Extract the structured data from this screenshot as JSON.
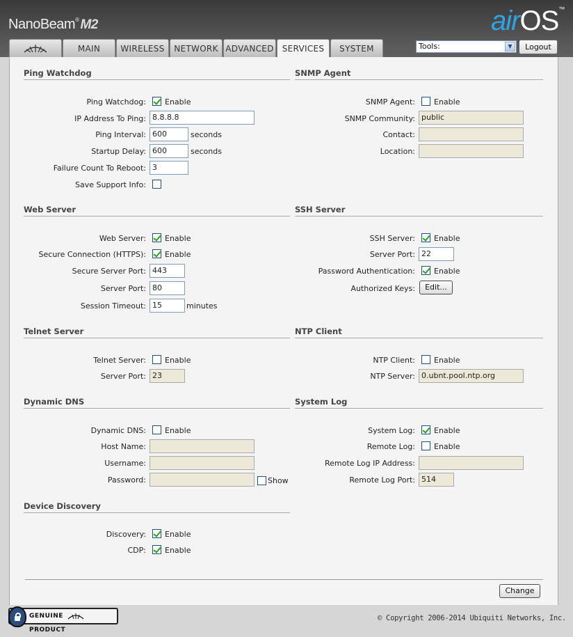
{
  "header": {
    "product_name": "NanoBeam",
    "product_tm": "®",
    "product_model": "M2",
    "brand_air": "air",
    "brand_os": "OS",
    "brand_tm": "™"
  },
  "tabs": [
    {
      "label": "",
      "icon": "ubiquiti-logo-icon"
    },
    {
      "label": "MAIN"
    },
    {
      "label": "WIRELESS"
    },
    {
      "label": "NETWORK"
    },
    {
      "label": "ADVANCED"
    },
    {
      "label": "SERVICES",
      "active": true
    },
    {
      "label": "SYSTEM"
    }
  ],
  "toolbar": {
    "tools_value": "Tools:",
    "logout_label": "Logout"
  },
  "common": {
    "enable": "Enable",
    "seconds": "seconds",
    "minutes": "minutes",
    "show": "Show"
  },
  "ping_watchdog": {
    "title": "Ping Watchdog",
    "enable_label": "Ping Watchdog:",
    "enabled": true,
    "ip_label": "IP Address To Ping:",
    "ip_value": "8.8.8.8",
    "interval_label": "Ping Interval:",
    "interval_value": "600",
    "startup_label": "Startup Delay:",
    "startup_value": "600",
    "failure_label": "Failure Count To Reboot:",
    "failure_value": "3",
    "support_label": "Save Support Info:",
    "support_checked": false
  },
  "snmp": {
    "title": "SNMP Agent",
    "enable_label": "SNMP Agent:",
    "enabled": false,
    "community_label": "SNMP Community:",
    "community_value": "public",
    "contact_label": "Contact:",
    "contact_value": "",
    "location_label": "Location:",
    "location_value": ""
  },
  "web_server": {
    "title": "Web Server",
    "enable_label": "Web Server:",
    "enabled": true,
    "https_label": "Secure Connection (HTTPS):",
    "https_enabled": true,
    "secure_port_label": "Secure Server Port:",
    "secure_port_value": "443",
    "port_label": "Server Port:",
    "port_value": "80",
    "timeout_label": "Session Timeout:",
    "timeout_value": "15"
  },
  "ssh": {
    "title": "SSH Server",
    "enable_label": "SSH Server:",
    "enabled": true,
    "port_label": "Server Port:",
    "port_value": "22",
    "password_label": "Password Authentication:",
    "password_enabled": true,
    "keys_label": "Authorized Keys:",
    "edit_label": "Edit..."
  },
  "telnet": {
    "title": "Telnet Server",
    "enable_label": "Telnet Server:",
    "enabled": false,
    "port_label": "Server Port:",
    "port_value": "23"
  },
  "ntp": {
    "title": "NTP Client",
    "enable_label": "NTP Client:",
    "enabled": false,
    "server_label": "NTP Server:",
    "server_value": "0.ubnt.pool.ntp.org"
  },
  "ddns": {
    "title": "Dynamic DNS",
    "enable_label": "Dynamic DNS:",
    "enabled": false,
    "host_label": "Host Name:",
    "host_value": "",
    "username_label": "Username:",
    "username_value": "",
    "password_label": "Password:",
    "password_value": "",
    "show_checked": false
  },
  "syslog": {
    "title": "System Log",
    "enable_label": "System Log:",
    "enabled": true,
    "remote_label": "Remote Log:",
    "remote_enabled": false,
    "remote_ip_label": "Remote Log IP Address:",
    "remote_ip_value": "",
    "remote_port_label": "Remote Log Port:",
    "remote_port_value": "514"
  },
  "discovery": {
    "title": "Device Discovery",
    "discovery_label": "Discovery:",
    "discovery_enabled": true,
    "cdp_label": "CDP:",
    "cdp_enabled": true
  },
  "actions": {
    "change_label": "Change"
  },
  "footer": {
    "badge_left": "GENUINE",
    "badge_right": "PRODUCT",
    "copyright": "© Copyright 2006-2014 Ubiquiti Networks, Inc."
  }
}
